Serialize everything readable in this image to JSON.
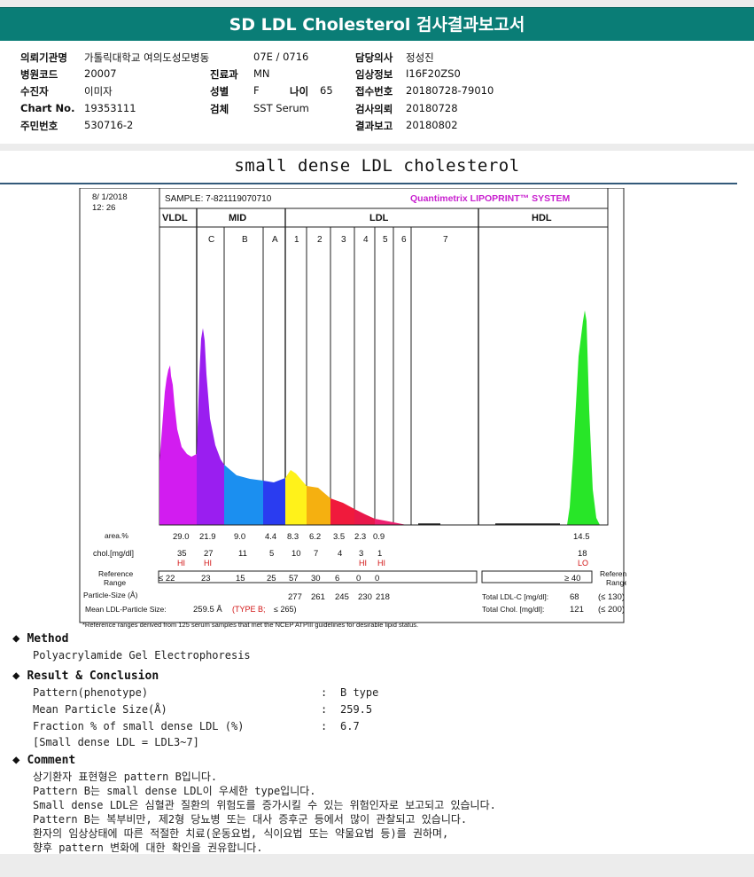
{
  "header": {
    "title": "SD LDL Cholesterol 검사결과보고서"
  },
  "info": {
    "institution_label": "의뢰기관명",
    "institution": "가톨릭대학교 여의도성모병동",
    "ward": "07E / 0716",
    "doctor_label": "담당의사",
    "doctor": "정성진",
    "hospital_code_label": "병원코드",
    "hospital_code": "20007",
    "dept_label": "진료과",
    "dept": "MN",
    "clinical_label": "임상정보",
    "clinical": "I16F20ZS0",
    "patient_label": "수진자",
    "patient": "이미자",
    "sex_label": "성별",
    "sex": "F",
    "age_label": "나이",
    "age": "65",
    "receipt_label": "접수번호",
    "receipt": "20180728-79010",
    "chart_label": "Chart No.",
    "chart_no": "19353111",
    "specimen_label": "검체",
    "specimen": "SST Serum",
    "request_label": "검사의뢰",
    "request_date": "20180728",
    "resident_label": "주민번호",
    "resident": "530716-2",
    "report_label": "결과보고",
    "report_date": "20180802"
  },
  "report": {
    "title": "small dense LDL cholesterol"
  },
  "chart_data": {
    "type": "area",
    "title": "Quantimetrix LIPOPRINT™ SYSTEM",
    "datetime": [
      "8/ 1/2018",
      "12: 26"
    ],
    "sample": "SAMPLE:  7-821119070710",
    "groups": [
      "VLDL",
      "MID",
      "LDL",
      "HDL"
    ],
    "bands": [
      "C",
      "B",
      "A",
      "1",
      "2",
      "3",
      "4",
      "5",
      "6",
      "7"
    ],
    "area_label": "area.%",
    "areas": [
      "29.0",
      "21.9",
      "9.0",
      "4.4",
      "8.3",
      "6.2",
      "3.5",
      "2.3",
      "0.9",
      "14.5"
    ],
    "chol_label": "chol.[mg/dl]",
    "chol": [
      "35",
      "27",
      "11",
      "5",
      "10",
      "7",
      "4",
      "3",
      "1",
      "18"
    ],
    "flags": [
      "HI",
      "HI",
      "",
      "",
      "",
      "",
      "",
      "HI",
      "HI",
      "LO"
    ],
    "ref_label": [
      "Reference",
      "Range"
    ],
    "ref": [
      "≤ 22",
      "23",
      "15",
      "25",
      "57",
      "30",
      "6",
      "0",
      "0",
      "≥ 40"
    ],
    "particle_label": "Particle-Size (Å)",
    "particle_sizes": [
      "277",
      "261",
      "245",
      "230",
      "218"
    ],
    "total_ldl_label": "Total LDL-C [mg/dl]:",
    "total_ldl": "68",
    "total_ldl_ref": "(≤ 130)",
    "total_chol_label": "Total Chol. [mg/dl]:",
    "total_chol": "121",
    "total_chol_ref": "(≤ 200)",
    "mean_label": "Mean LDL-Particle Size:",
    "mean_value": "259.5 Å",
    "mean_type": "(TYPE B;",
    "mean_ref": "≤ 265)",
    "footnote": "*Reference ranges derived from 125 serum samples that met the NCEP ATPIII guidelines for desirable lipid status.",
    "colors": {
      "vldl": "#d21cf0",
      "c": "#9a1ef0",
      "b": "#1b8ff0",
      "a": "#2a3cf0",
      "l1": "#fff21a",
      "l2": "#f5b010",
      "l3": "#f01a3c",
      "l4": "#e8184a",
      "hdl": "#28e628",
      "title": "#c81fcf",
      "flag": "#d21414"
    }
  },
  "method": {
    "heading": "Method",
    "text": "Polyacrylamide Gel Electrophoresis"
  },
  "result": {
    "heading": "Result & Conclusion",
    "rows": [
      {
        "label": "Pattern(phenotype)",
        "sep": ":",
        "value": "B type"
      },
      {
        "label": "Mean Particle Size(Å)",
        "sep": ":",
        "value": "259.5"
      },
      {
        "label": "Fraction % of small dense LDL (%)",
        "sep": ":",
        "value": "6.7"
      }
    ],
    "note": "[Small dense LDL = LDL3~7]"
  },
  "comment": {
    "heading": "Comment",
    "lines": [
      "상기환자 표현형은 pattern B입니다.",
      "Pattern B는 small dense LDL이 우세한 type입니다.",
      "Small dense LDL은 심혈관 질환의 위험도를 증가시킬 수 있는 위험인자로 보고되고 있습니다.",
      "Pattern B는 복부비만, 제2형 당뇨병 또는 대사 증후군 등에서 많이 관찰되고 있습니다.",
      "환자의 임상상태에 따른 적절한 치료(운동요법, 식이요법 또는 약물요법 등)를 권하며,",
      "향후 pattern 변화에 대한 확인을 권유합니다."
    ]
  }
}
